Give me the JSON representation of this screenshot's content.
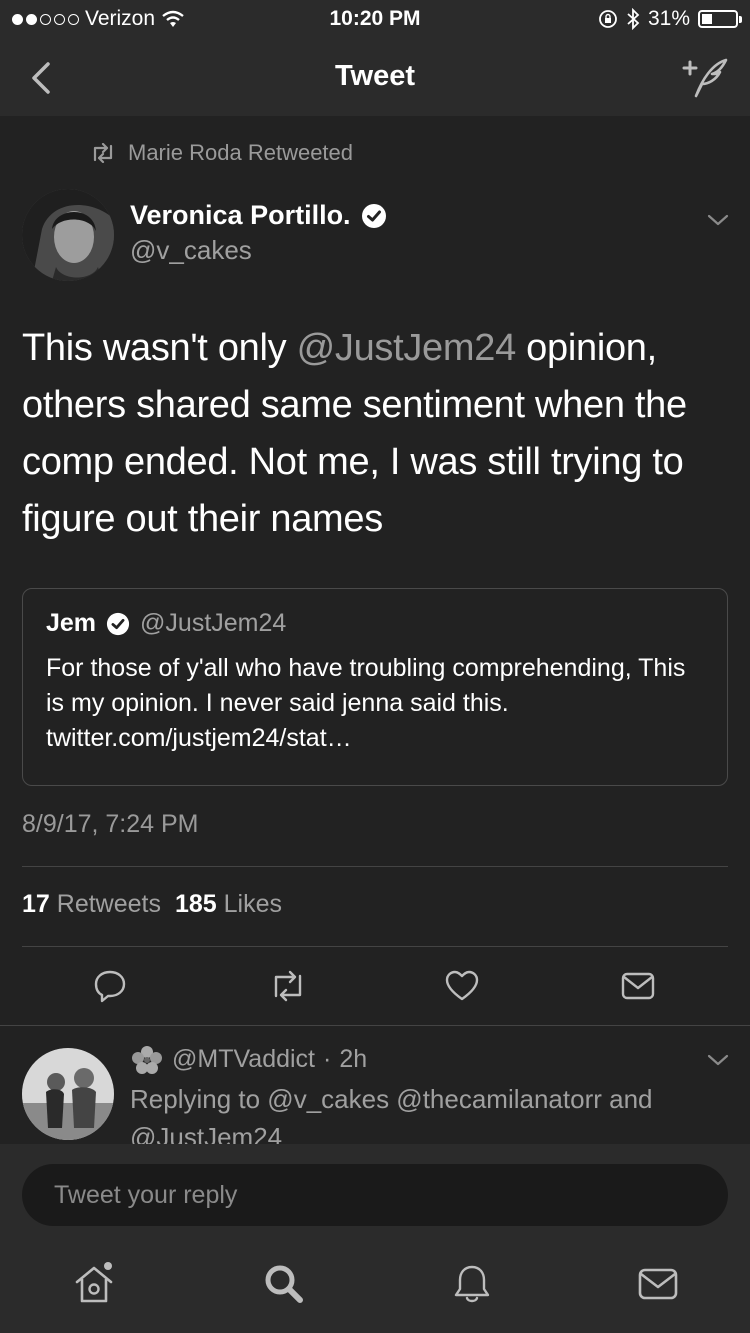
{
  "status_bar": {
    "carrier": "Verizon",
    "time": "10:20 PM",
    "battery": "31%",
    "battery_level": 0.31,
    "signal_bars_filled": 2,
    "signal_bars_total": 5
  },
  "nav": {
    "title": "Tweet"
  },
  "tweet": {
    "retweeted_by": "Marie Roda Retweeted",
    "author_name": "Veronica Portillo.",
    "author_handle": "@v_cakes",
    "text_before": "This wasn't only ",
    "mention": "@JustJem24",
    "text_after": " opinion, others shared same sentiment when the comp ended. Not me, I was still trying to figure out their names",
    "quote": {
      "name": "Jem",
      "handle": "@JustJem24",
      "text": "For those of y'all who have troubling comprehending, This is my opinion. I never said jenna said this. twitter.com/justjem24/stat…"
    },
    "timestamp": "8/9/17, 7:24 PM",
    "retweets_count": "17",
    "retweets_label": "Retweets",
    "likes_count": "185",
    "likes_label": "Likes"
  },
  "reply_preview": {
    "handle": "@MTVaddict",
    "separator": "·",
    "age": "2h",
    "text": "Replying to @v_cakes @thecamilanatorr and @JustJem24"
  },
  "composer": {
    "placeholder": "Tweet your reply"
  },
  "colors": {
    "background": "#222222",
    "bar": "#2b2b2b",
    "muted": "#9a9a9a",
    "text": "#ffffff"
  },
  "icons": [
    "back-icon",
    "compose-icon",
    "retweet-icon",
    "verified-icon",
    "chevron-down-icon",
    "reply-icon",
    "like-icon",
    "message-icon",
    "home-icon",
    "search-icon",
    "notifications-icon"
  ]
}
